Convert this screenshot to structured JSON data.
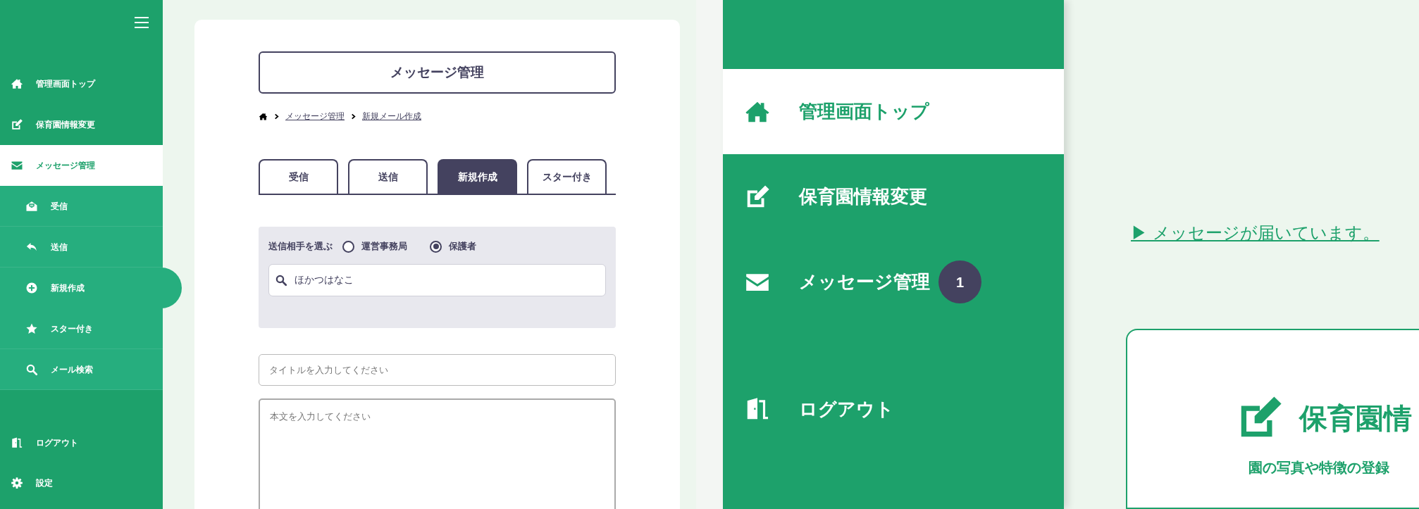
{
  "left_panel": {
    "sidebar": {
      "items": [
        {
          "label": "管理画面トップ",
          "selected": false
        },
        {
          "label": "保育園情報変更",
          "selected": false
        },
        {
          "label": "メッセージ管理",
          "selected": true,
          "expanded": true,
          "children": [
            {
              "label": "受信",
              "selected": false
            },
            {
              "label": "送信",
              "selected": false
            },
            {
              "label": "新規作成",
              "selected": true
            },
            {
              "label": "スター付き",
              "selected": false
            },
            {
              "label": "メール検索",
              "selected": false
            }
          ]
        }
      ],
      "bottom_items": [
        {
          "label": "ログアウト"
        },
        {
          "label": "設定"
        }
      ]
    },
    "main": {
      "title": "メッセージ管理",
      "breadcrumb": [
        "メッセージ管理",
        "新規メール作成"
      ],
      "tabs": [
        {
          "label": "受信",
          "selected": false
        },
        {
          "label": "送信",
          "selected": false
        },
        {
          "label": "新規作成",
          "selected": true
        },
        {
          "label": "スター付き",
          "selected": false
        }
      ],
      "recipient": {
        "label": "送信相手を選ぶ",
        "options": [
          {
            "label": "運営事務局",
            "selected": false
          },
          {
            "label": "保護者",
            "selected": true
          }
        ],
        "search": {
          "value": "ほかつはなこ"
        }
      },
      "title_field": {
        "placeholder": "タイトルを入力してください"
      },
      "body_field": {
        "placeholder": "本文を入力してください"
      }
    }
  },
  "right_panel": {
    "sidebar": {
      "items": [
        {
          "label": "管理画面トップ",
          "selected": true
        },
        {
          "label": "保育園情報変更",
          "selected": false
        },
        {
          "label": "メッセージ管理",
          "selected": false,
          "badge": "1"
        }
      ],
      "bottom_items": [
        {
          "label": "ログアウト"
        }
      ]
    },
    "notice_link": "▶ メッセージが届いています。",
    "card": {
      "title": "保育園情",
      "subtitle": "園の写真や特徴の登録"
    }
  }
}
